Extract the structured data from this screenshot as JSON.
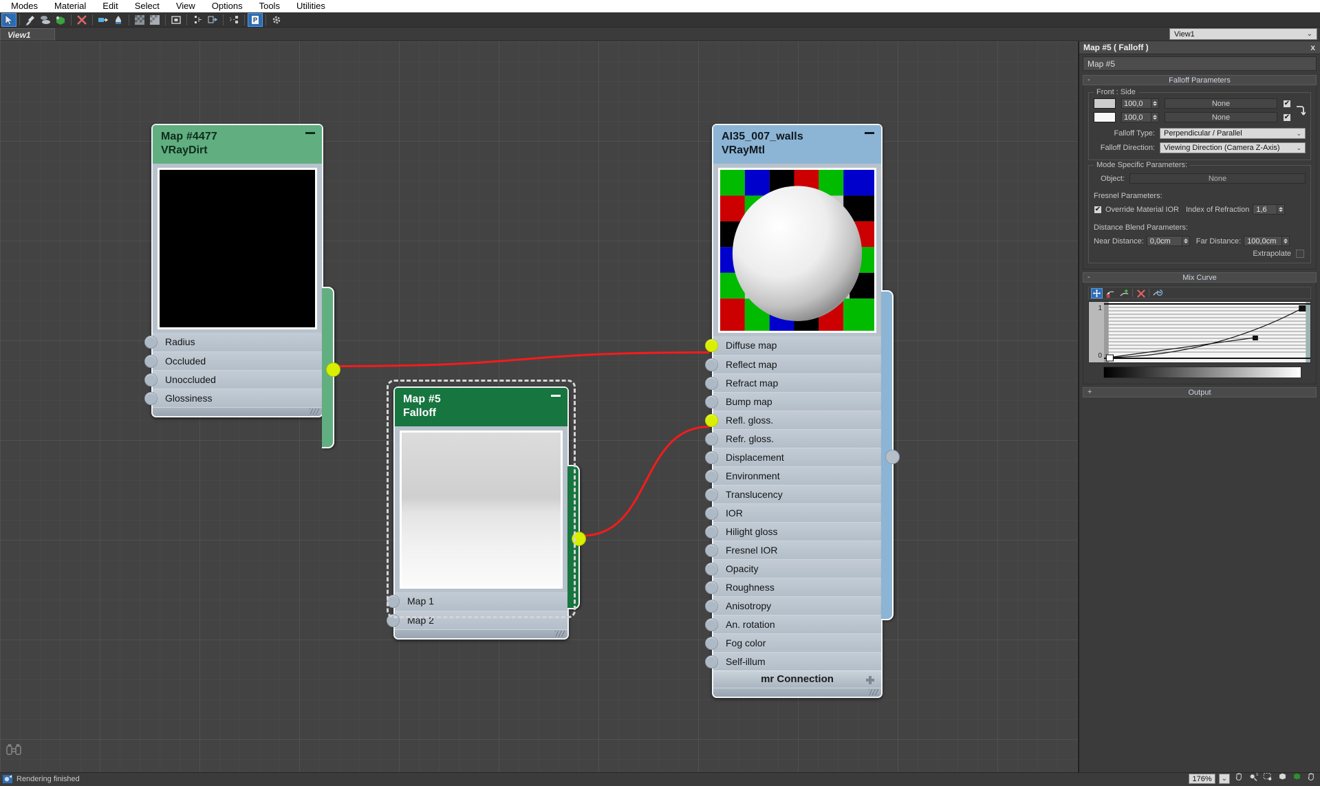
{
  "menubar": {
    "items": [
      {
        "label": "Modes"
      },
      {
        "label": "Material"
      },
      {
        "label": "Edit"
      },
      {
        "label": "Select"
      },
      {
        "label": "View"
      },
      {
        "label": "Options"
      },
      {
        "label": "Tools"
      },
      {
        "label": "Utilities"
      }
    ]
  },
  "toolbar": {
    "buttons": [
      {
        "name": "select-tool",
        "icon": "arrow-cursor-icon",
        "selected": true
      },
      {
        "name": "pick-material-tool",
        "icon": "eyedropper-icon",
        "selected": false
      },
      {
        "name": "assign-material-tool",
        "icon": "assign-material-icon",
        "selected": false
      },
      {
        "name": "show-in-viewport-tool",
        "icon": "cube-green-icon",
        "selected": false
      },
      {
        "name": "delete-tool",
        "icon": "red-x-icon",
        "selected": false
      },
      {
        "name": "move-children-tool",
        "icon": "move-children-icon",
        "selected": false
      },
      {
        "name": "put-material-to-scene-tool",
        "icon": "put-to-scene-icon",
        "selected": false
      },
      {
        "name": "show-background-tool",
        "icon": "checker-dark-icon",
        "selected": false
      },
      {
        "name": "show-background2-tool",
        "icon": "checker-light-icon",
        "selected": false
      },
      {
        "name": "render-map-tool",
        "icon": "render-map-icon",
        "selected": false
      },
      {
        "name": "select-by-material-tool",
        "icon": "select-by-material-icon",
        "selected": false
      },
      {
        "name": "material-id-tool",
        "icon": "material-id-icon",
        "selected": false
      },
      {
        "name": "layout-children-tool",
        "icon": "layout-children-icon",
        "selected": false
      },
      {
        "name": "parameter-editor-tool",
        "icon": "parameter-editor-icon",
        "selected": true
      },
      {
        "name": "options-tool",
        "icon": "gear-icon",
        "selected": false
      }
    ]
  },
  "viewtab": {
    "label": "View1"
  },
  "viewselector": {
    "value": "View1"
  },
  "nodes": [
    {
      "id": "vraydirt",
      "title": "Map #4477",
      "subtitle": "VRayDirt",
      "header_color": "#61ae81",
      "header_text_color": "#0d2b1a",
      "selected": false,
      "preview_kind": "black",
      "output_socket": "connected",
      "sockets": [
        {
          "label": "Radius",
          "connected": false
        },
        {
          "label": "Occluded",
          "connected": false
        },
        {
          "label": "Unoccluded",
          "connected": false
        },
        {
          "label": "Glossiness",
          "connected": false
        }
      ]
    },
    {
      "id": "falloff",
      "title": "Map #5",
      "subtitle": "Falloff",
      "header_color": "#17753f",
      "header_text_color": "#ffffff",
      "selected": true,
      "preview_kind": "gradient",
      "output_socket": "connected",
      "sockets": [
        {
          "label": "Map 1",
          "connected": false
        },
        {
          "label": "Map 2",
          "connected": false
        }
      ]
    },
    {
      "id": "vraymtl",
      "title": "AI35_007_walls",
      "subtitle": "VRayMtl",
      "header_color": "#8cb4d4",
      "header_text_color": "#101820",
      "selected": false,
      "preview_kind": "sphere",
      "output_socket": "unconnected",
      "footer_label": "mr Connection",
      "sockets": [
        {
          "label": "Diffuse map",
          "connected": true
        },
        {
          "label": "Reflect map",
          "connected": false
        },
        {
          "label": "Refract map",
          "connected": false
        },
        {
          "label": "Bump map",
          "connected": false
        },
        {
          "label": "Refl. gloss.",
          "connected": true
        },
        {
          "label": "Refr. gloss.",
          "connected": false
        },
        {
          "label": "Displacement",
          "connected": false
        },
        {
          "label": "Environment",
          "connected": false
        },
        {
          "label": "Translucency",
          "connected": false
        },
        {
          "label": "IOR",
          "connected": false
        },
        {
          "label": "Hilight gloss",
          "connected": false
        },
        {
          "label": "Fresnel IOR",
          "connected": false
        },
        {
          "label": "Opacity",
          "connected": false
        },
        {
          "label": "Roughness",
          "connected": false
        },
        {
          "label": "Anisotropy",
          "connected": false
        },
        {
          "label": "An. rotation",
          "connected": false
        },
        {
          "label": "Fog color",
          "connected": false
        },
        {
          "label": "Self-illum",
          "connected": false
        }
      ]
    }
  ],
  "wires": {
    "color": "#f61b1b"
  },
  "panel": {
    "title": "Map #5  ( Falloff )",
    "close_label": "x",
    "name_value": "Map #5",
    "falloff": {
      "header": "Falloff Parameters",
      "collapse": "-",
      "group_label": "Front : Side",
      "rows": [
        {
          "swatch": "#cccccc",
          "amount": "100,0",
          "map": "None",
          "checked": true
        },
        {
          "swatch": "#f7f7f7",
          "amount": "100,0",
          "map": "None",
          "checked": true
        }
      ],
      "swap_icon": "swap-arrow-icon",
      "type_label": "Falloff Type:",
      "type_value": "Perpendicular / Parallel",
      "direction_label": "Falloff Direction:",
      "direction_value": "Viewing Direction (Camera Z-Axis)",
      "mode_group": "Mode Specific Parameters:",
      "object_label": "Object:",
      "object_value": "None",
      "fresnel_group": "Fresnel Parameters:",
      "override_ior_label": "Override Material IOR",
      "override_ior_checked": true,
      "ior_label": "Index of Refraction",
      "ior_value": "1,6",
      "distance_group": "Distance Blend Parameters:",
      "near_label": "Near Distance:",
      "near_value": "0,0cm",
      "far_label": "Far Distance:",
      "far_value": "100,0cm",
      "extrapolate_label": "Extrapolate",
      "extrapolate_checked": false
    },
    "mixcurve": {
      "header": "Mix Curve",
      "collapse": "-",
      "tools": [
        {
          "name": "move-point-tool",
          "icon": "move-point-icon",
          "selected": true
        },
        {
          "name": "scale-point-tool",
          "icon": "scale-point-icon",
          "selected": false
        },
        {
          "name": "add-point-tool",
          "icon": "add-point-icon",
          "selected": false
        },
        {
          "name": "delete-point-tool",
          "icon": "delete-point-icon",
          "selected": false
        },
        {
          "name": "reset-curve-tool",
          "icon": "reset-curve-icon",
          "selected": false
        }
      ],
      "y_top": "1",
      "y_bottom": "0"
    },
    "output": {
      "header": "Output",
      "collapse": "+"
    }
  },
  "status": {
    "icon": "render-status-icon",
    "text": "Rendering finished",
    "zoom": "176%",
    "nav_icons": [
      {
        "name": "pan-icon"
      },
      {
        "name": "zoom-icon"
      },
      {
        "name": "zoom-region-icon"
      },
      {
        "name": "zoom-extents-icon"
      },
      {
        "name": "zoom-extents-selected-icon"
      },
      {
        "name": "pan-all-icon"
      }
    ]
  },
  "canvas": {
    "binoculars_icon": "binoculars-icon"
  }
}
